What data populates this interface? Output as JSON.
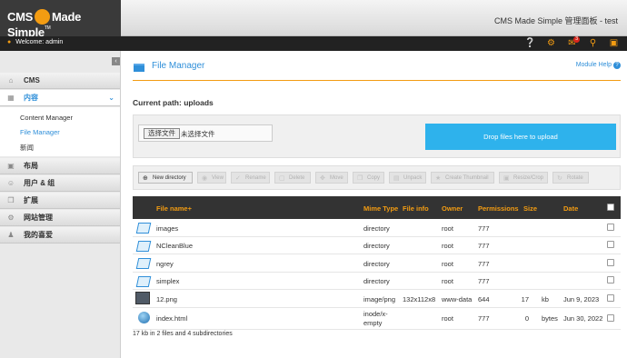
{
  "header": {
    "logo_left": "CMS",
    "logo_right": "Made Simple",
    "logo_tm": "TM",
    "site_title": "CMS Made Simple 管理面板 - test"
  },
  "userbar": {
    "welcome": "Welcome: admin",
    "notification_count": "3"
  },
  "sidebar": {
    "sections": [
      {
        "label": "CMS",
        "icon": "home-icon"
      },
      {
        "label": "内容",
        "icon": "content-icon",
        "active": true
      },
      {
        "label": "布局",
        "icon": "layout-icon"
      },
      {
        "label": "用户 & 组",
        "icon": "users-icon"
      },
      {
        "label": "扩展",
        "icon": "puzzle-icon"
      },
      {
        "label": "网站管理",
        "icon": "gear-icon"
      },
      {
        "label": "我的喜爱",
        "icon": "user-icon"
      }
    ],
    "subitems": [
      "Content Manager",
      "File Manager",
      "新闻"
    ]
  },
  "main": {
    "title": "File Manager",
    "module_help": "Module Help",
    "current_path": "Current path: uploads",
    "file_button": "选择文件",
    "file_none": "未选择文件",
    "drop_zone": "Drop files here to upload",
    "toolbar": [
      "New directory",
      "View",
      "Rename",
      "Delete",
      "Move",
      "Copy",
      "Unpack",
      "Create Thumbnail",
      "Resize/Crop",
      "Rotate"
    ],
    "columns": [
      "File name+",
      "Mime Type",
      "File info",
      "Owner",
      "Permissions",
      "Size",
      "Date"
    ],
    "rows": [
      {
        "name": "images",
        "type": "directory",
        "info": "",
        "owner": "root",
        "perm": "777",
        "size": "",
        "unit": "",
        "date": "",
        "icon": "folder-icon"
      },
      {
        "name": "NCleanBlue",
        "type": "directory",
        "info": "",
        "owner": "root",
        "perm": "777",
        "size": "",
        "unit": "",
        "date": "",
        "icon": "folder-icon"
      },
      {
        "name": "ngrey",
        "type": "directory",
        "info": "",
        "owner": "root",
        "perm": "777",
        "size": "",
        "unit": "",
        "date": "",
        "icon": "folder-icon"
      },
      {
        "name": "simplex",
        "type": "directory",
        "info": "",
        "owner": "root",
        "perm": "777",
        "size": "",
        "unit": "",
        "date": "",
        "icon": "folder-icon"
      },
      {
        "name": "12.png",
        "type": "image/png",
        "info": "132x112x8",
        "owner": "www-data",
        "perm": "644",
        "size": "17",
        "unit": "kb",
        "date": "Jun 9, 2023",
        "icon": "image-thumbnail-icon"
      },
      {
        "name": "index.html",
        "type": "inode/x-\nempty",
        "info": "",
        "owner": "root",
        "perm": "777",
        "size": "0",
        "unit": "bytes",
        "date": "Jun 30, 2022",
        "icon": "globe-icon"
      }
    ],
    "summary": "17 kb in 2 files and 4 subdirectories"
  },
  "colors": {
    "accent": "#2f8fd9",
    "orange": "#f39c12",
    "drop": "#2eb2ec"
  }
}
